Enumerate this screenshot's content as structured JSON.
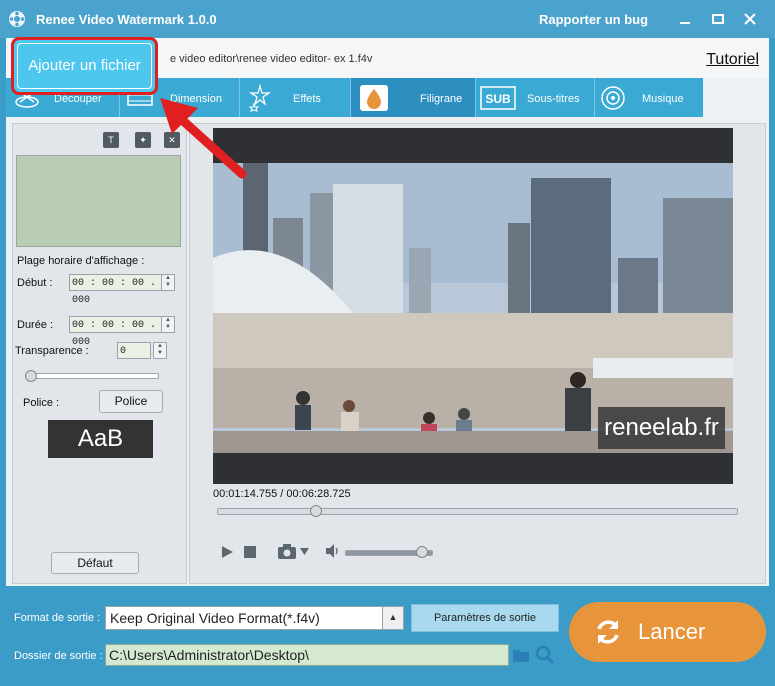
{
  "window": {
    "title": "Renee Video Watermark 1.0.0",
    "bug_link": "Rapporter un bug"
  },
  "toolbar": {
    "path": "e video editor\\renee video editor- ex 1.f4v",
    "tutorial_link": "Tutoriel",
    "add_file": "Ajouter un fichier"
  },
  "tabs": [
    {
      "label": "Découper",
      "icon": "cut-icon"
    },
    {
      "label": "Dimension",
      "icon": "film-icon"
    },
    {
      "label": "Effets",
      "icon": "stars-icon"
    },
    {
      "label": "Filigrane",
      "icon": "watermark-drop-icon",
      "active": true
    },
    {
      "label": "Sous-titres",
      "icon": "sub-icon"
    },
    {
      "label": "Musique",
      "icon": "music-disc-icon"
    }
  ],
  "watermark_panel": {
    "display_range_label": "Plage horaire d'affichage :",
    "start_label": "Début :",
    "start_value": "00 : 00 : 00 . 000",
    "duration_label": "Durée :",
    "duration_value": "00 : 00 : 00 . 000",
    "transparency_label": "Transparence :",
    "transparency_value": "0",
    "transparency_slider": 0,
    "font_label": "Police :",
    "font_button": "Police",
    "font_preview": "AaB",
    "default_button": "Défaut"
  },
  "player": {
    "watermark_text": "reneelab.fr",
    "current_time": "00:01:14.755",
    "total_time": "00:06:28.725",
    "time_separator": " / ",
    "seek_progress": 0.19,
    "volume_level": 0.9
  },
  "output": {
    "format_label": "Format de sortie :",
    "format_value": "Keep Original Video Format(*.f4v)",
    "params_button": "Paramètres de sortie",
    "folder_label": "Dossier de sortie :",
    "folder_value": "C:\\Users\\Administrator\\Desktop\\",
    "start_button": "Lancer"
  },
  "colors": {
    "title_bar": "#4aa3cc",
    "tab_bar": "#3aa9d3",
    "active_tab": "#2d8fc0",
    "start_button": "#e8943a",
    "highlight": "#e02020"
  }
}
